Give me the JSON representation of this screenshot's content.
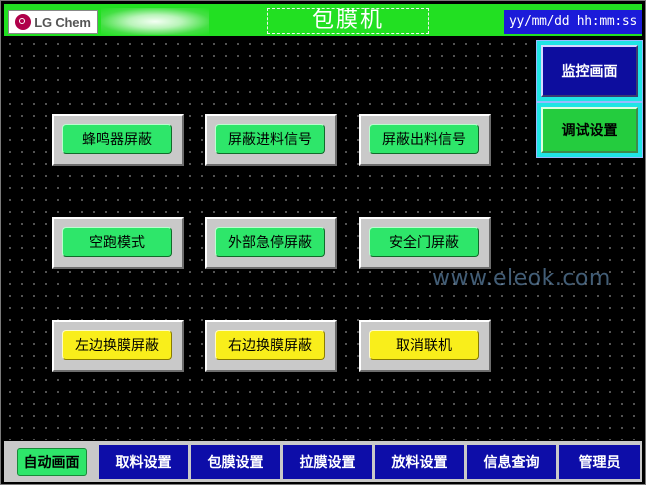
{
  "header": {
    "brand": "LG Chem",
    "title": "包膜机",
    "datetime": "yy/mm/dd hh:mm:ss"
  },
  "side_nav": [
    {
      "label": "监控画面"
    },
    {
      "label": "调试设置"
    }
  ],
  "buttons": [
    {
      "label": "蜂鸣器屏蔽",
      "color": "#2ee66a"
    },
    {
      "label": "屏蔽进料信号",
      "color": "#2ee66a"
    },
    {
      "label": "屏蔽出料信号",
      "color": "#2ee66a"
    },
    {
      "label": "空跑模式",
      "color": "#2ee66a"
    },
    {
      "label": "外部急停屏蔽",
      "color": "#2ee66a"
    },
    {
      "label": "安全门屏蔽",
      "color": "#2ee66a"
    },
    {
      "label": "左边换膜屏蔽",
      "color": "#f9ee1b"
    },
    {
      "label": "右边换膜屏蔽",
      "color": "#f9ee1b"
    },
    {
      "label": "取消联机",
      "color": "#f9ee1b"
    }
  ],
  "tabs": [
    {
      "label": "自动画面",
      "active": true
    },
    {
      "label": "取料设置"
    },
    {
      "label": "包膜设置"
    },
    {
      "label": "拉膜设置"
    },
    {
      "label": "放料设置"
    },
    {
      "label": "信息查询"
    },
    {
      "label": "管理员"
    }
  ],
  "watermark": "www.eleok.com",
  "colors": {
    "header_green": "#22e022",
    "datetime_bg": "#1b1bd9",
    "nav_blue": "#0d0da8",
    "button_green": "#2ee66a",
    "button_yellow": "#f9ee1b"
  }
}
